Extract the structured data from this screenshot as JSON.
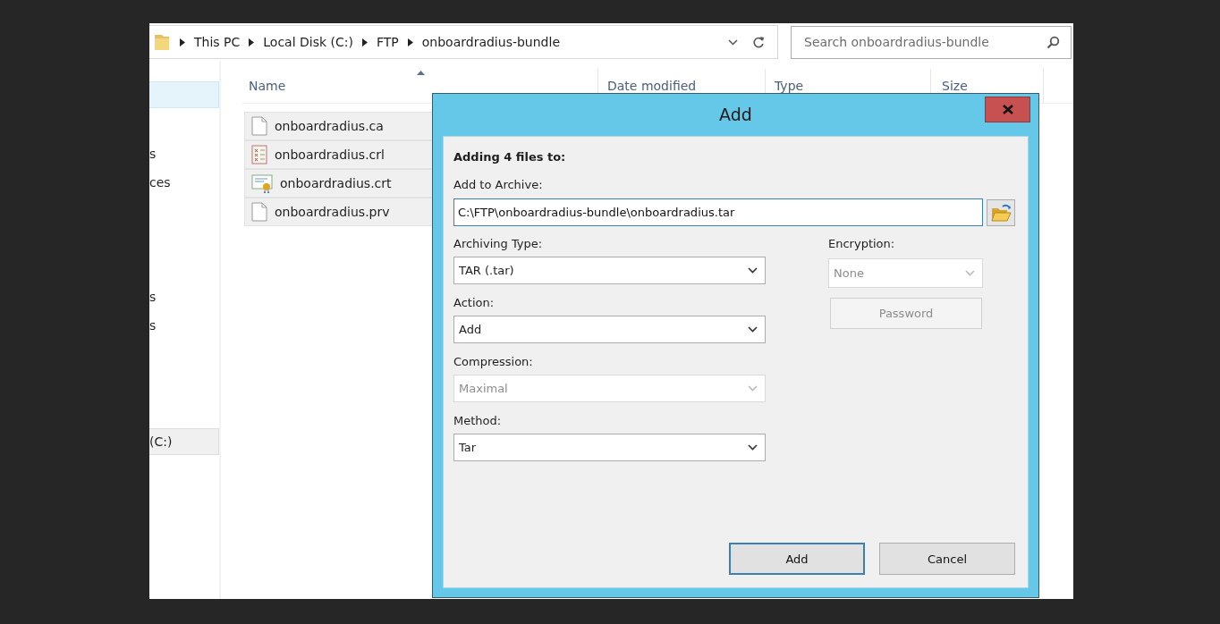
{
  "address_bar": {
    "crumbs": [
      "This PC",
      "Local Disk (C:)",
      "FTP",
      "onboardradius-bundle"
    ]
  },
  "search": {
    "placeholder": "Search onboardradius-bundle"
  },
  "sidebar": {
    "groups": [
      {
        "items": [
          {
            "hovered": true,
            "selected": false
          }
        ]
      },
      {
        "items": [
          {
            "text": "s",
            "hovered": false,
            "selected": false
          },
          {
            "text": "ces",
            "hovered": false,
            "selected": false
          }
        ]
      },
      {
        "items": [
          {
            "text": "s",
            "hovered": false,
            "selected": false
          },
          {
            "text": "s",
            "hovered": false,
            "selected": false
          }
        ]
      },
      {
        "items": [
          {
            "text": "(C:)",
            "hovered": false,
            "selected": true
          }
        ]
      }
    ]
  },
  "columns": [
    {
      "label": "Name",
      "sorted": true
    },
    {
      "label": "Date modified",
      "sorted": false
    },
    {
      "label": "Type",
      "sorted": false
    },
    {
      "label": "Size",
      "sorted": false
    }
  ],
  "files": [
    {
      "name": "onboardradius.ca",
      "kind": "document",
      "selected": true
    },
    {
      "name": "onboardradius.crl",
      "kind": "list",
      "selected": true
    },
    {
      "name": "onboardradius.crt",
      "kind": "certificate",
      "selected": true
    },
    {
      "name": "onboardradius.prv",
      "kind": "document",
      "selected": true
    }
  ],
  "dialog": {
    "title": "Add",
    "heading": "Adding 4 files to:",
    "archive_label": "Add to Archive:",
    "archive_path": "C:\\FTP\\onboardradius-bundle\\onboardradius.tar",
    "fields": [
      {
        "label": "Archiving Type:",
        "value": "TAR (.tar)",
        "disabled": false
      },
      {
        "label": "Action:",
        "value": "Add",
        "disabled": false
      },
      {
        "label": "Compression:",
        "value": "Maximal",
        "disabled": true
      },
      {
        "label": "Method:",
        "value": "Tar",
        "disabled": false
      }
    ],
    "encryption": {
      "label": "Encryption:",
      "value": "None",
      "disabled": true
    },
    "password_button": {
      "label": "Password",
      "disabled": true
    },
    "buttons": [
      {
        "label": "Add",
        "default": true
      },
      {
        "label": "Cancel",
        "default": false
      }
    ]
  }
}
